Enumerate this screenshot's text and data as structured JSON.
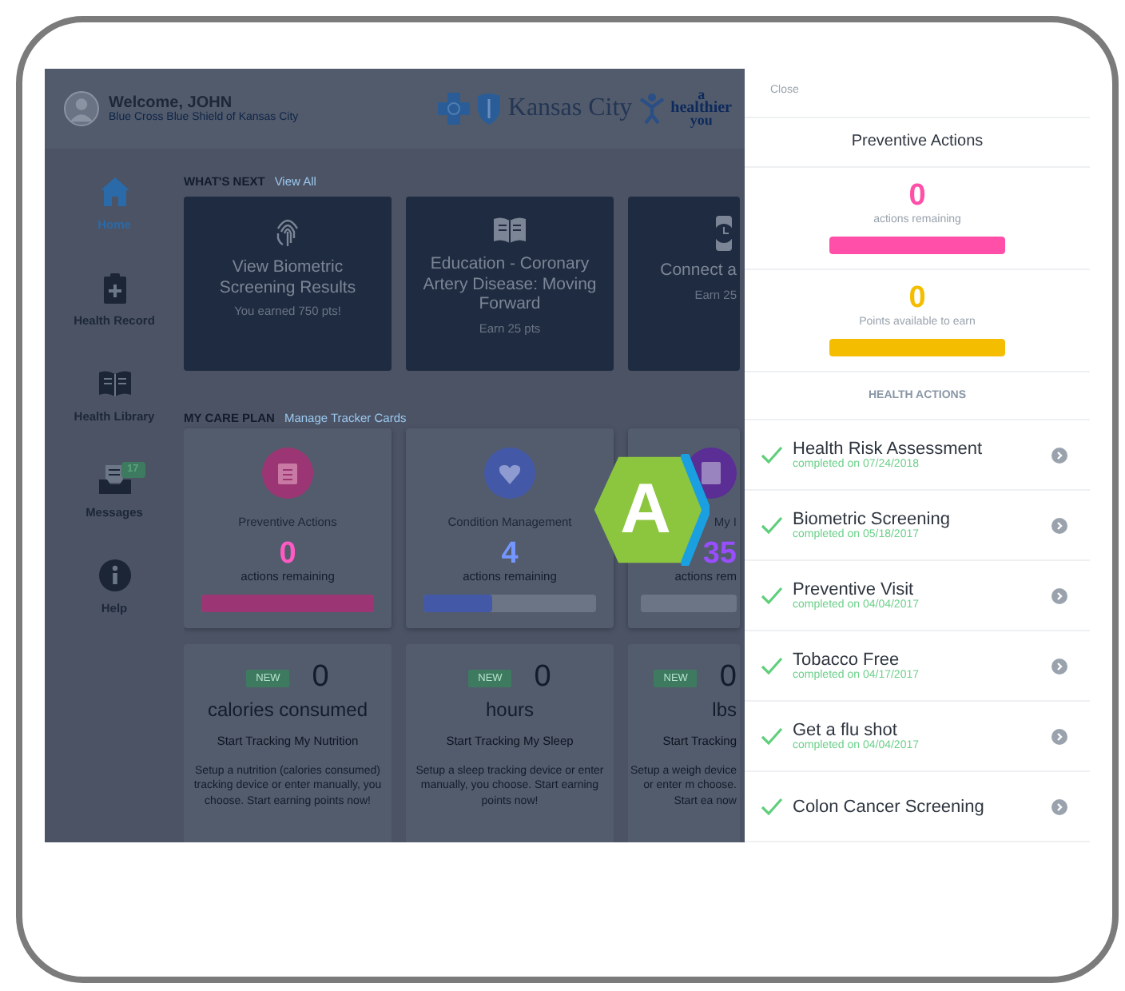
{
  "header": {
    "greeting": "Welcome, JOHN",
    "subtitle": "Blue Cross Blue Shield of Kansas City",
    "brand": "Kansas City",
    "tagline": [
      "a",
      "healthier",
      "you"
    ]
  },
  "sidebar": {
    "items": [
      {
        "label": "Home",
        "selected": true
      },
      {
        "label": "Health Record",
        "selected": false
      },
      {
        "label": "Health Library",
        "selected": false
      },
      {
        "label": "Messages",
        "selected": false,
        "badge": "17"
      },
      {
        "label": "Help",
        "selected": false
      }
    ]
  },
  "whats_next": {
    "title": "WHAT'S NEXT",
    "link": "View All",
    "cards": [
      {
        "title": "View Biometric Screening Results",
        "note": "You earned 750 pts!"
      },
      {
        "title": "Education - Coronary Artery Disease: Moving Forward",
        "note": "Earn 25 pts"
      },
      {
        "title": "Connect a",
        "note": "Earn 25"
      }
    ]
  },
  "care_plan": {
    "title": "MY CARE PLAN",
    "link": "Manage Tracker Cards",
    "cards": [
      {
        "name": "Preventive Actions",
        "count": "0",
        "caption": "actions remaining",
        "color": "#9b3573",
        "level": 1
      },
      {
        "name": "Condition Management",
        "count": "4",
        "caption": "actions remaining",
        "color": "#4458a8",
        "level": 0.4
      },
      {
        "name": "My I",
        "count": "35",
        "caption": "actions rem",
        "color": "#5a2e95",
        "level": 0
      }
    ]
  },
  "trackers": [
    {
      "badge": "NEW",
      "value": "0",
      "unit": "calories consumed",
      "title": "Start Tracking My Nutrition",
      "text": "Setup a nutrition (calories consumed) tracking device or enter manually, you choose. Start earning points now!"
    },
    {
      "badge": "NEW",
      "value": "0",
      "unit": "hours",
      "title": "Start Tracking My Sleep",
      "text": "Setup a sleep tracking device or enter manually, you choose. Start earning points now!"
    },
    {
      "badge": "NEW",
      "value": "0",
      "unit": "lbs",
      "title": "Start Tracking",
      "text": "Setup a weigh device or enter m choose. Start ea now"
    }
  ],
  "drawer": {
    "close": "Close",
    "title": "Preventive Actions",
    "stats": [
      {
        "value": "0",
        "caption": "actions remaining",
        "color": "#ff4fa8",
        "level": 1
      },
      {
        "value": "0",
        "caption": "Points available to earn",
        "color": "#f5bd00",
        "level": 1
      }
    ],
    "section": "HEALTH ACTIONS",
    "actions": [
      {
        "name": "Health Risk Assessment",
        "status": "completed on 07/24/2018",
        "completed": true
      },
      {
        "name": "Biometric Screening",
        "status": "completed on 05/18/2017",
        "completed": true
      },
      {
        "name": "Preventive Visit",
        "status": "completed on 04/04/2017",
        "completed": true
      },
      {
        "name": "Tobacco Free",
        "status": "completed on 04/17/2017",
        "completed": true
      },
      {
        "name": "Get a flu shot",
        "status": "completed on 04/04/2017",
        "completed": true
      },
      {
        "name": "Colon Cancer Screening",
        "completed": true
      }
    ]
  },
  "step_badge": {
    "letter": "A"
  }
}
